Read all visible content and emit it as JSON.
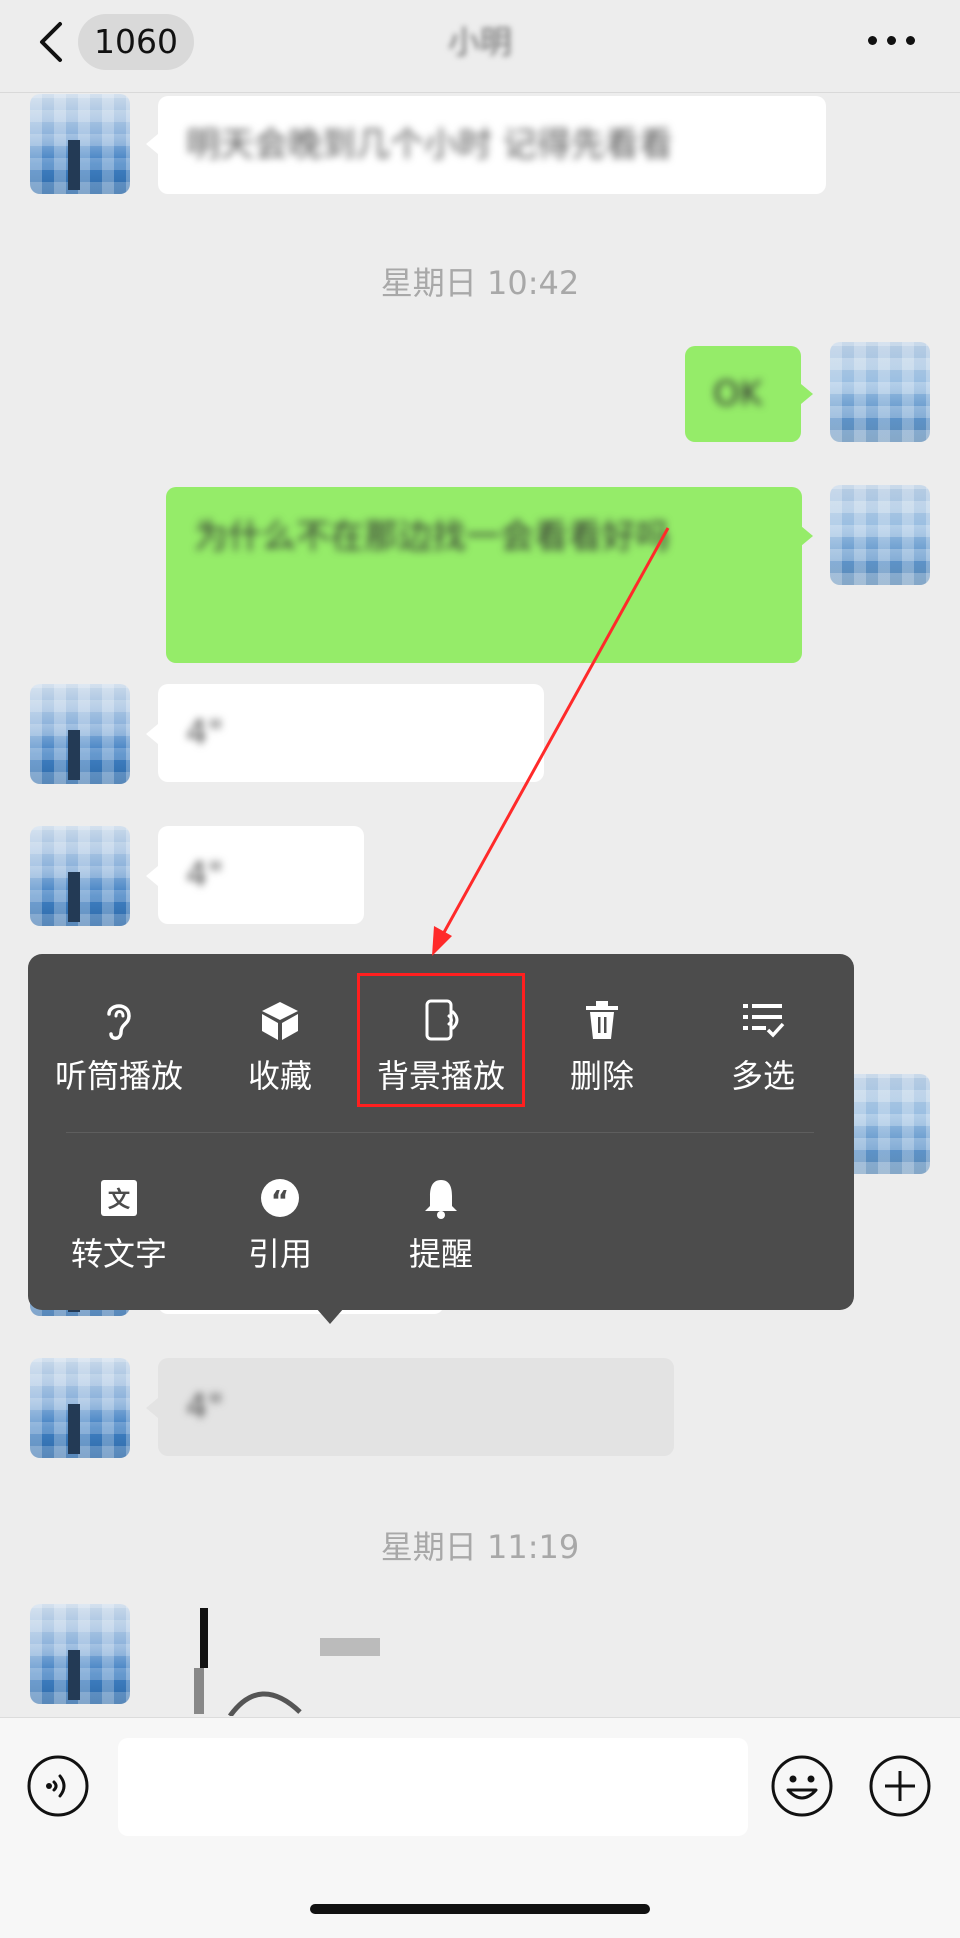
{
  "header": {
    "back_badge": "1060",
    "title": "小明",
    "back_icon": "chevron-left-icon",
    "more_icon": "ellipsis-icon"
  },
  "timestamps": [
    "星期日 10:42",
    "星期日 11:19"
  ],
  "messages": [
    {
      "side": "left",
      "text": "明天会晚到几个小时 记得先看看"
    },
    {
      "side": "right",
      "text": "OK"
    },
    {
      "side": "right",
      "text": "为什么不在那边找一会看看好吗"
    },
    {
      "side": "left",
      "text": "4\" ",
      "type": "voice"
    },
    {
      "side": "left",
      "text": "4\" ",
      "type": "voice"
    },
    {
      "side": "left",
      "text": "4\" ",
      "type": "voice"
    }
  ],
  "context_menu": {
    "row1": [
      {
        "label": "听筒播放",
        "icon": "ear-icon"
      },
      {
        "label": "收藏",
        "icon": "cube-icon"
      },
      {
        "label": "背景播放",
        "icon": "phone-speaker-icon"
      },
      {
        "label": "删除",
        "icon": "trash-icon"
      },
      {
        "label": "多选",
        "icon": "checklist-icon"
      }
    ],
    "row2": [
      {
        "label": "转文字",
        "icon": "text-convert-icon"
      },
      {
        "label": "引用",
        "icon": "quote-icon"
      },
      {
        "label": "提醒",
        "icon": "bell-icon"
      }
    ],
    "highlighted": "背景播放"
  },
  "annotation": {
    "color": "#ff1f1f"
  },
  "input_bar": {
    "voice_icon": "voice-icon",
    "emoji_icon": "emoji-icon",
    "plus_icon": "plus-icon",
    "placeholder": ""
  },
  "colors": {
    "green_bubble": "#95ec69",
    "menu_bg": "#4c4c4c",
    "background": "#ededed"
  }
}
